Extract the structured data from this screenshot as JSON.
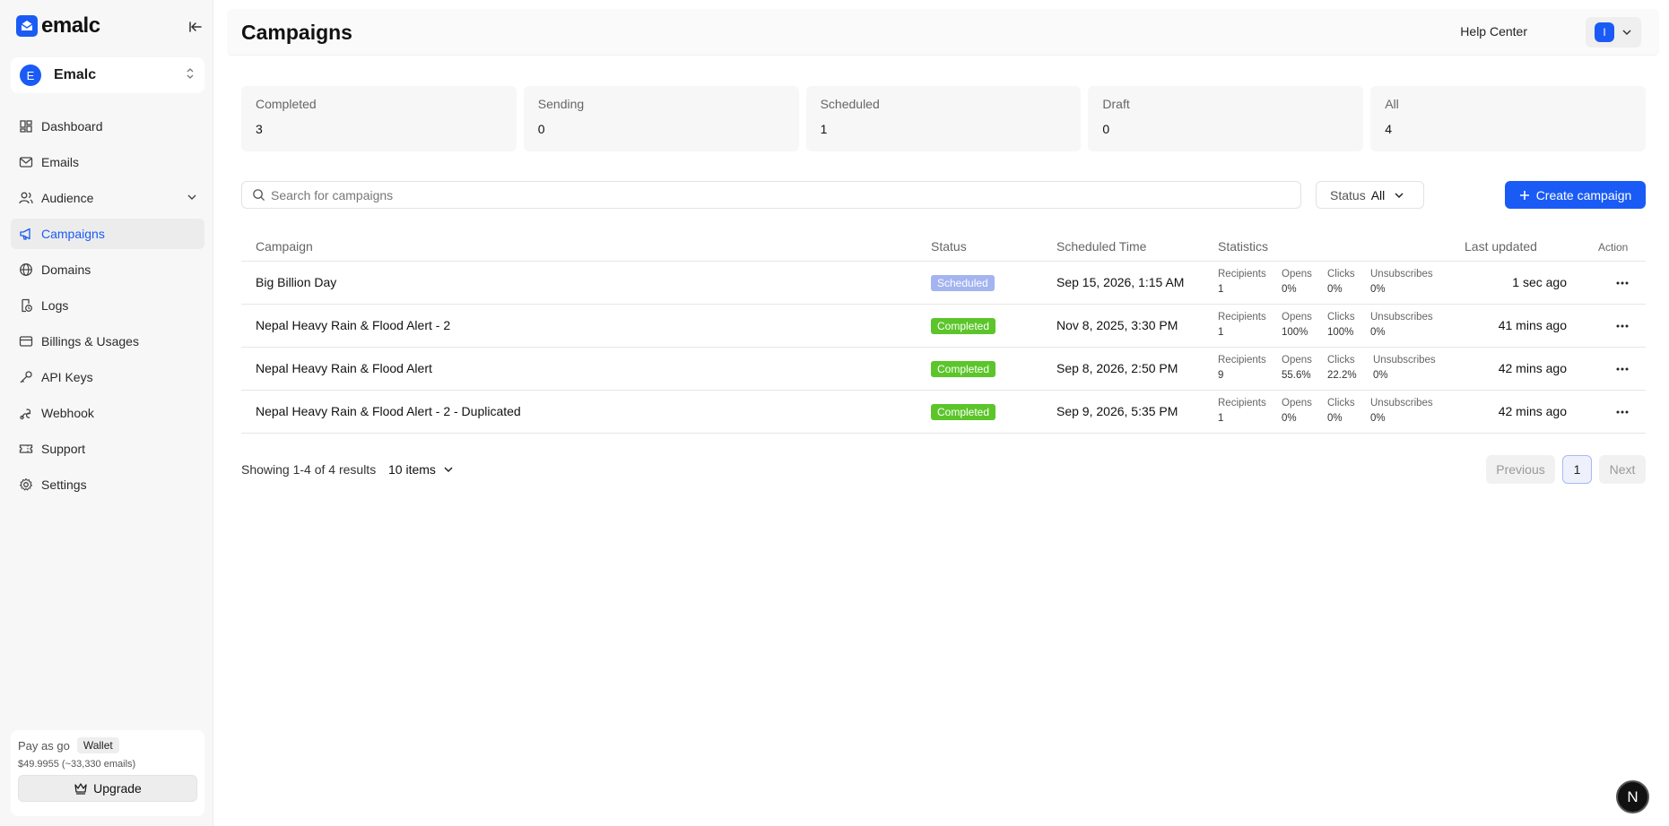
{
  "brand": {
    "name": "emalc",
    "accent": "#1a5bf5"
  },
  "workspace": {
    "avatar": "E",
    "name": "Emalc"
  },
  "sidebar": {
    "items": [
      {
        "label": "Dashboard",
        "icon": "dashboard-icon"
      },
      {
        "label": "Emails",
        "icon": "mail-icon"
      },
      {
        "label": "Audience",
        "icon": "users-icon",
        "expandable": true
      },
      {
        "label": "Campaigns",
        "icon": "megaphone-icon",
        "active": true
      },
      {
        "label": "Domains",
        "icon": "globe-icon"
      },
      {
        "label": "Logs",
        "icon": "logs-icon"
      },
      {
        "label": "Billings & Usages",
        "icon": "credit-card-icon"
      },
      {
        "label": "API Keys",
        "icon": "key-icon"
      },
      {
        "label": "Webhook",
        "icon": "webhook-icon"
      },
      {
        "label": "Support",
        "icon": "ticket-icon"
      },
      {
        "label": "Settings",
        "icon": "gear-icon"
      }
    ]
  },
  "billing": {
    "plan": "Pay as go",
    "wallet_label": "Wallet",
    "balance": "$49.9955 (~33,330 emails)",
    "upgrade_label": "Upgrade"
  },
  "header": {
    "title": "Campaigns",
    "help_label": "Help Center",
    "user_initial": "I"
  },
  "stats": [
    {
      "label": "Completed",
      "value": "3"
    },
    {
      "label": "Sending",
      "value": "0"
    },
    {
      "label": "Scheduled",
      "value": "1"
    },
    {
      "label": "Draft",
      "value": "0"
    },
    {
      "label": "All",
      "value": "4"
    }
  ],
  "toolbar": {
    "search_placeholder": "Search for campaigns",
    "status_label": "Status",
    "status_value": "All",
    "create_label": "Create campaign"
  },
  "table": {
    "columns": {
      "campaign": "Campaign",
      "status": "Status",
      "scheduled": "Scheduled Time",
      "statistics": "Statistics",
      "updated": "Last updated",
      "action": "Action"
    },
    "stat_labels": {
      "recipients": "Recipients",
      "opens": "Opens",
      "clicks": "Clicks",
      "unsubscribes": "Unsubscribes"
    },
    "rows": [
      {
        "name": "Big Billion Day",
        "status": "Scheduled",
        "status_color": "#a3b4f0",
        "scheduled": "Sep 15, 2026, 1:15 AM",
        "recipients": "1",
        "opens": "0%",
        "clicks": "0%",
        "unsubscribes": "0%",
        "updated": "1 sec ago"
      },
      {
        "name": "Nepal Heavy Rain & Flood Alert - 2",
        "status": "Completed",
        "status_color": "#5bc52a",
        "scheduled": "Nov 8, 2025, 3:30 PM",
        "recipients": "1",
        "opens": "100%",
        "clicks": "100%",
        "unsubscribes": "0%",
        "updated": "41 mins ago"
      },
      {
        "name": "Nepal Heavy Rain & Flood Alert",
        "status": "Completed",
        "status_color": "#5bc52a",
        "scheduled": "Sep 8, 2026, 2:50 PM",
        "recipients": "9",
        "opens": "55.6%",
        "clicks": "22.2%",
        "unsubscribes": "0%",
        "updated": "42 mins ago"
      },
      {
        "name": "Nepal Heavy Rain & Flood Alert - 2 - Duplicated",
        "status": "Completed",
        "status_color": "#5bc52a",
        "scheduled": "Sep 9, 2026, 5:35 PM",
        "recipients": "1",
        "opens": "0%",
        "clicks": "0%",
        "unsubscribes": "0%",
        "updated": "42 mins ago"
      }
    ]
  },
  "pagination": {
    "showing": "Showing 1-4 of 4 results",
    "per_page": "10 items",
    "previous": "Previous",
    "current": "1",
    "next": "Next"
  },
  "dev_badge": "N"
}
